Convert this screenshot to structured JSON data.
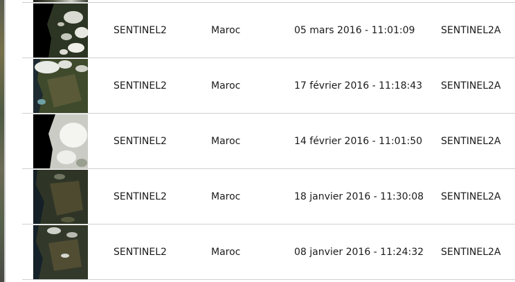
{
  "results": {
    "rows": [
      {
        "source": "SENTINEL2",
        "country": "Maroc",
        "date": "05 mars 2016 - 11:01:09",
        "satellite": "SENTINEL2A"
      },
      {
        "source": "SENTINEL2",
        "country": "Maroc",
        "date": "17 février 2016 - 11:18:43",
        "satellite": "SENTINEL2A"
      },
      {
        "source": "SENTINEL2",
        "country": "Maroc",
        "date": "14 février 2016 - 11:01:50",
        "satellite": "SENTINEL2A"
      },
      {
        "source": "SENTINEL2",
        "country": "Maroc",
        "date": "18 janvier 2016 - 11:30:08",
        "satellite": "SENTINEL2A"
      },
      {
        "source": "SENTINEL2",
        "country": "Maroc",
        "date": "08 janvier 2016 - 11:24:32",
        "satellite": "SENTINEL2A"
      }
    ]
  }
}
